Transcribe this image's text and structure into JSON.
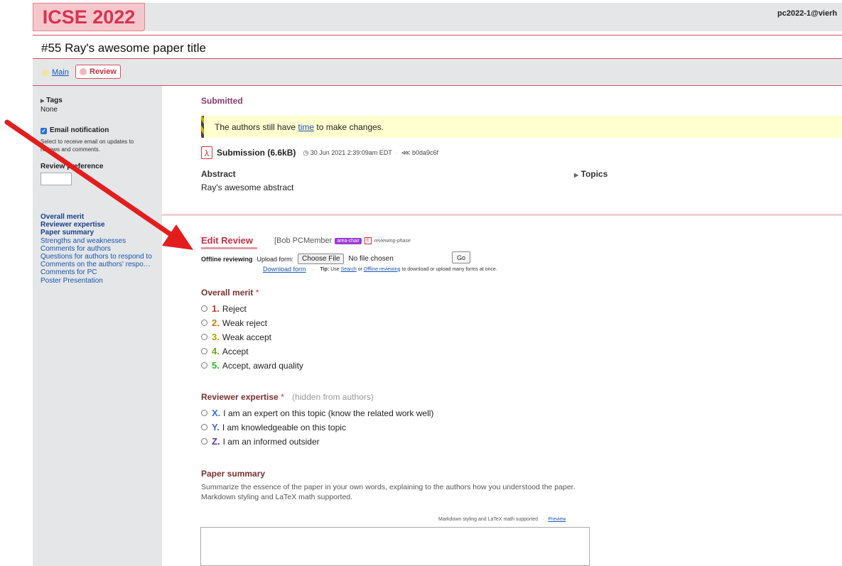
{
  "header": {
    "logo": "ICSE 2022",
    "account": "pc2022-1@vierh"
  },
  "paper": {
    "title": "#55  Ray's awesome paper title"
  },
  "tabs": {
    "main": "Main",
    "review": "Review"
  },
  "sidebar": {
    "tags_label": "Tags",
    "tags_value": "None",
    "email_label": "Email notification",
    "email_desc": "Select to receive email on updates to reviews and comments.",
    "email_checked": true,
    "pref_label": "Review preference",
    "toc": [
      {
        "label": "Overall merit",
        "bold": true
      },
      {
        "label": "Reviewer expertise",
        "bold": true
      },
      {
        "label": "Paper summary",
        "bold": true
      },
      {
        "label": "Strengths and weaknesses",
        "bold": false
      },
      {
        "label": "Comments for authors",
        "bold": false
      },
      {
        "label": "Questions for authors to respond to",
        "bold": false
      },
      {
        "label": "Comments on the authors' respo…",
        "bold": false
      },
      {
        "label": "Comments for PC",
        "bold": false
      },
      {
        "label": "Poster Presentation",
        "bold": false
      }
    ]
  },
  "submission": {
    "status": "Submitted",
    "notice_prefix": "The authors still have",
    "notice_link": "time",
    "notice_suffix": "to make changes.",
    "file_label": "Submission (6.6kB)",
    "timestamp": "30 Jun 2021 2:39:09am EDT",
    "hash": "b0da9c6f",
    "abstract_heading": "Abstract",
    "abstract_text": "Ray's awesome abstract",
    "topics_label": "Topics"
  },
  "edit_review": {
    "title": "Edit Review",
    "reviewer": "[Bob PCMember",
    "badge": "area-chair",
    "phase_icon": "E",
    "phase": "reviewing-phase",
    "offline_label": "Offline reviewing",
    "upload_label": "Upload form:",
    "choose_file": "Choose File",
    "no_file": "No file chosen",
    "go": "Go",
    "download_form": "Download form",
    "tip_prefix": "Tip:",
    "tip_use": "Use",
    "tip_search": "Search",
    "tip_or": "or",
    "tip_offline": "Offline reviewing",
    "tip_rest": "to download or upload many forms at once."
  },
  "overall_merit": {
    "heading": "Overall merit",
    "required": "*",
    "options": [
      {
        "num": "1.",
        "label": "Reject",
        "color": "#c0392b"
      },
      {
        "num": "2.",
        "label": "Weak reject",
        "color": "#c7781a"
      },
      {
        "num": "3.",
        "label": "Weak accept",
        "color": "#b7a300"
      },
      {
        "num": "4.",
        "label": "Accept",
        "color": "#6fa81e"
      },
      {
        "num": "5.",
        "label": "Accept, award quality",
        "color": "#2fb52f"
      }
    ]
  },
  "reviewer_expertise": {
    "heading": "Reviewer expertise",
    "required": "*",
    "note": "(hidden from authors)",
    "options": [
      {
        "num": "X.",
        "label": "I am an expert on this topic (know the related work well)",
        "color": "#3a6fd8"
      },
      {
        "num": "Y.",
        "label": "I am knowledgeable on this topic",
        "color": "#4a5ec8"
      },
      {
        "num": "Z.",
        "label": "I am an informed outsider",
        "color": "#5a3a9a"
      }
    ]
  },
  "paper_summary": {
    "heading": "Paper summary",
    "description": "Summarize the essence of the paper in your own words, explaining to the authors how you understood the paper.",
    "markdown_note": "Markdown styling and LaTeX math supported.",
    "tools_note": "Markdown styling and LaTeX math supported",
    "preview": "Preview"
  }
}
